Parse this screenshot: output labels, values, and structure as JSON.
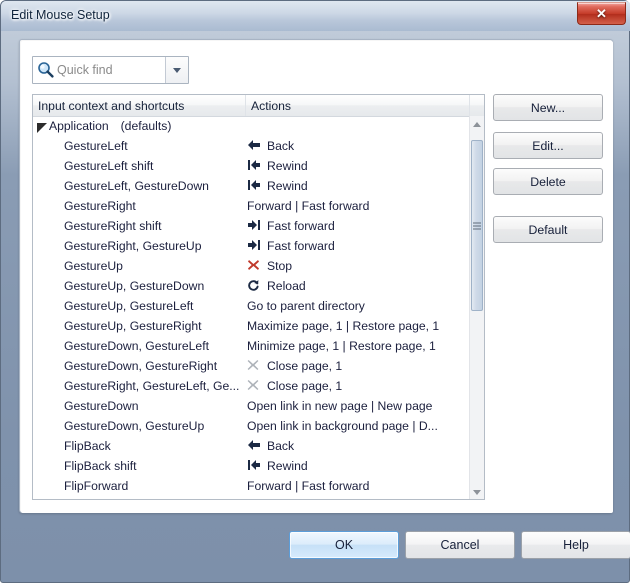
{
  "window": {
    "title": "Edit Mouse Setup",
    "close_label": "✕"
  },
  "search": {
    "placeholder": "Quick find",
    "value": "",
    "icon": "search-icon",
    "dropdown_icon": "chevron-down-icon"
  },
  "list": {
    "columns": [
      {
        "label": "Input context and shortcuts"
      },
      {
        "label": "Actions"
      }
    ],
    "group": {
      "label": "Application",
      "sublabel": "(defaults)",
      "expanded": true
    },
    "rows": [
      {
        "context": "GestureLeft",
        "icon": "back-arrow-icon",
        "action": "Back"
      },
      {
        "context": "GestureLeft shift",
        "icon": "rewind-icon",
        "action": "Rewind"
      },
      {
        "context": "GestureLeft, GestureDown",
        "icon": "rewind-icon",
        "action": "Rewind"
      },
      {
        "context": "GestureRight",
        "icon": "",
        "action": "Forward | Fast forward"
      },
      {
        "context": "GestureRight shift",
        "icon": "fast-forward-icon",
        "action": "Fast forward"
      },
      {
        "context": "GestureRight, GestureUp",
        "icon": "fast-forward-icon",
        "action": "Fast forward"
      },
      {
        "context": "GestureUp",
        "icon": "stop-icon",
        "action": "Stop"
      },
      {
        "context": "GestureUp, GestureDown",
        "icon": "reload-icon",
        "action": "Reload"
      },
      {
        "context": "GestureUp, GestureLeft",
        "icon": "",
        "action": "Go to parent directory"
      },
      {
        "context": "GestureUp, GestureRight",
        "icon": "",
        "action": "Maximize page, 1 | Restore page, 1"
      },
      {
        "context": "GestureDown, GestureLeft",
        "icon": "",
        "action": "Minimize page, 1 | Restore page, 1"
      },
      {
        "context": "GestureDown, GestureRight",
        "icon": "close-page-icon",
        "action": "Close page, 1"
      },
      {
        "context": "GestureRight, GestureLeft, Ge...",
        "icon": "close-page-icon",
        "action": "Close page, 1"
      },
      {
        "context": "GestureDown",
        "icon": "",
        "action": "Open link in new page | New page"
      },
      {
        "context": "GestureDown, GestureUp",
        "icon": "",
        "action": "Open link in background page | D..."
      },
      {
        "context": "FlipBack",
        "icon": "back-arrow-icon",
        "action": "Back"
      },
      {
        "context": "FlipBack shift",
        "icon": "rewind-icon",
        "action": "Rewind"
      },
      {
        "context": "FlipForward",
        "icon": "",
        "action": "Forward | Fast forward"
      }
    ]
  },
  "side_buttons": [
    {
      "label": "New..."
    },
    {
      "label": "Edit..."
    },
    {
      "label": "Delete"
    },
    {
      "label": "Default"
    }
  ],
  "bottom_buttons": {
    "ok": "OK",
    "cancel": "Cancel",
    "help": "Help"
  },
  "colors": {
    "accent": "#5b9dd9",
    "stop": "#c0392b",
    "text": "#1b1f3d",
    "close_button": "#c33a27"
  }
}
